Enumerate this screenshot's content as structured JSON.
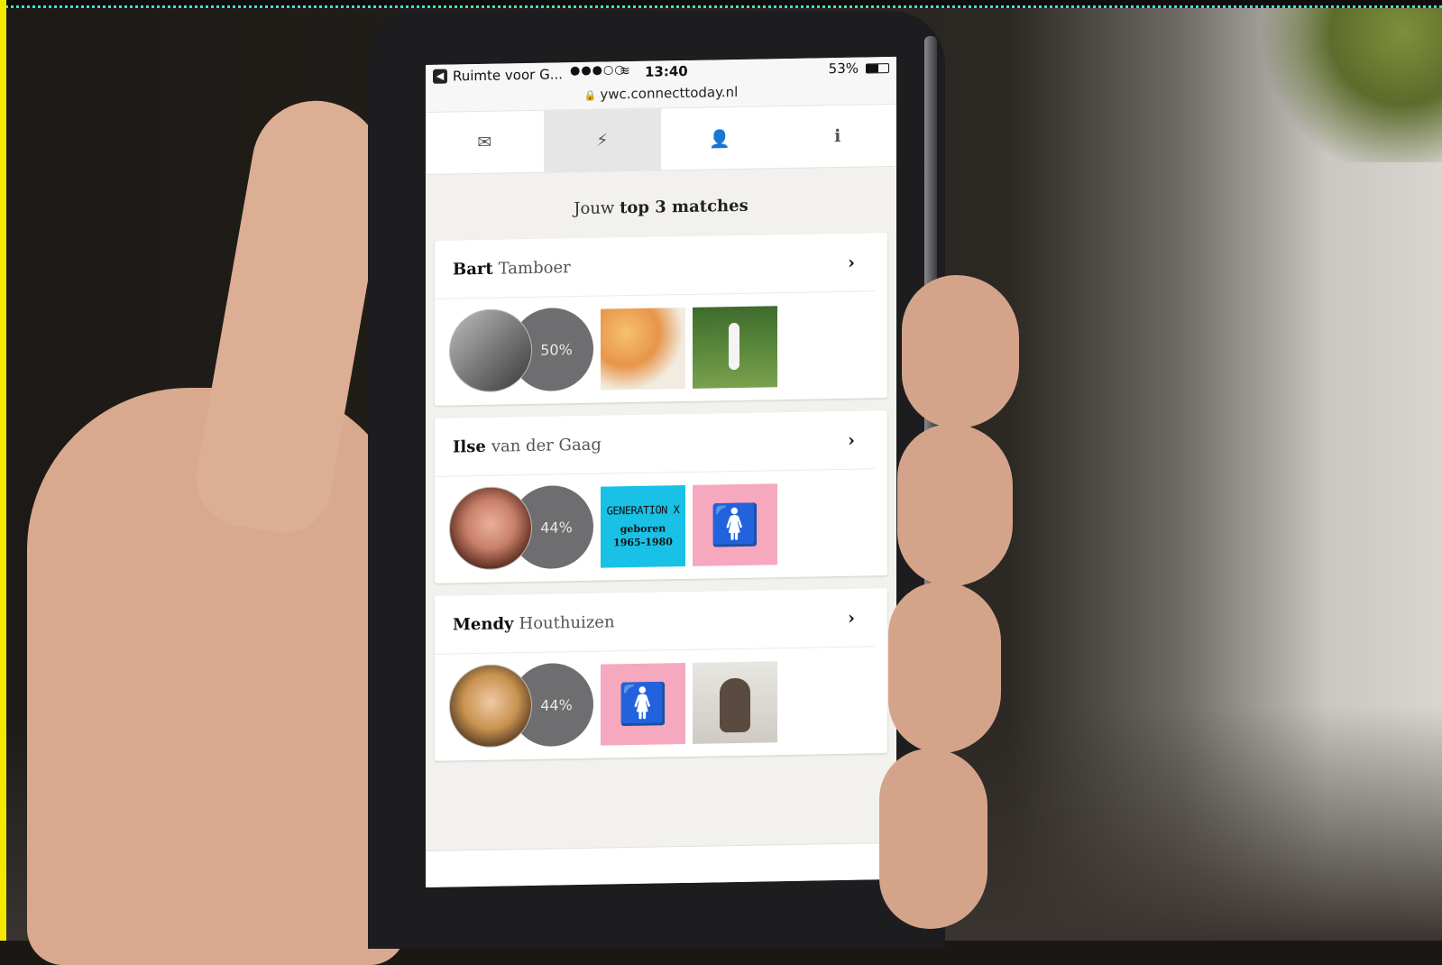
{
  "statusbar": {
    "back": "◀",
    "carrier": "Ruimte voor G...",
    "signal": "●●●○○",
    "wifi": "≋",
    "time": "13:40",
    "battery_percent": "53%",
    "battery_level": 0.53
  },
  "url": {
    "lock": "🔒",
    "text": "ywc.connecttoday.nl"
  },
  "tabs": [
    {
      "name": "messages",
      "icon": "envelope-icon",
      "glyph": "✉",
      "active": false
    },
    {
      "name": "matches",
      "icon": "lightning-icon",
      "glyph": "⚡",
      "active": true
    },
    {
      "name": "profile",
      "icon": "user-icon",
      "glyph": "👤",
      "active": false
    },
    {
      "name": "info",
      "icon": "info-icon",
      "glyph": "ℹ",
      "active": false
    }
  ],
  "heading": {
    "prefix": "Jouw",
    "bold": "top 3 matches"
  },
  "matches": [
    {
      "first": "Bart",
      "last": "Tamboer",
      "percent": "50%",
      "chevron": "›"
    },
    {
      "first": "Ilse",
      "last": "van der Gaag",
      "percent": "44%",
      "chevron": "›",
      "genx_title": "GENERATION X",
      "genx_line1": "geboren",
      "genx_line2": "1965-1980"
    },
    {
      "first": "Mendy",
      "last": "Houthuizen",
      "percent": "44%",
      "chevron": "›"
    }
  ],
  "colors": {
    "genx_tile": "#19c1e6",
    "female_tile": "#f5a8be",
    "frame_left": "#f5e800",
    "frame_top_dots": "#3fe0d0"
  },
  "icons": {
    "female": "🚺"
  }
}
